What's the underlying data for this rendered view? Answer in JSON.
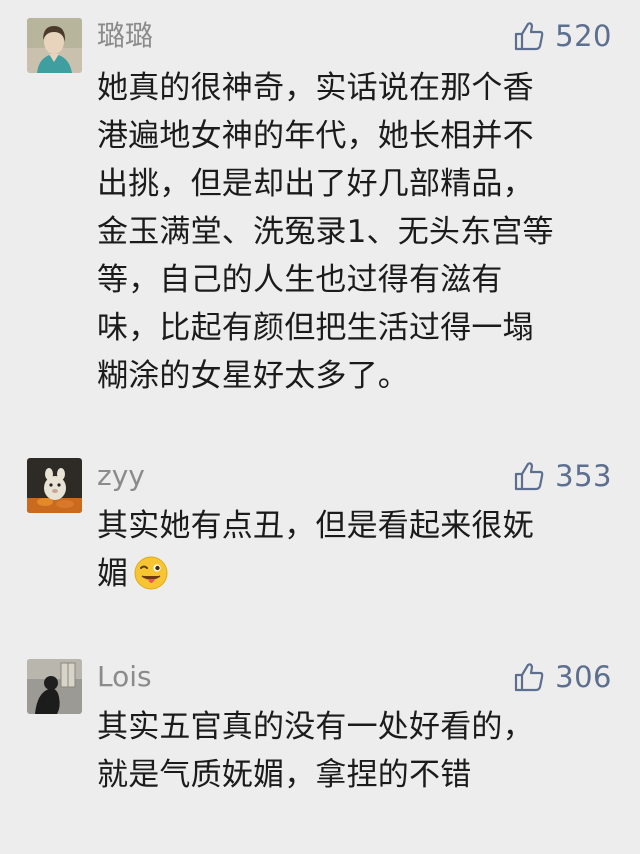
{
  "comments": [
    {
      "username": "璐璐",
      "likes": "520",
      "lines": [
        "她真的很神奇，实话说在那个香",
        "港遍地女神的年代，她长相并不",
        "出挑，但是却出了好几部精品，",
        "金玉满堂、洗冤录1、无头东宫等",
        "等，自己的人生也过得有滋有",
        "味，比起有颜但把生活过得一塌",
        "糊涂的女星好太多了。"
      ]
    },
    {
      "username": "zyy",
      "likes": "353",
      "lines": [
        "其实她有点丑，但是看起来很妩",
        "媚"
      ],
      "emoji": "winking-tongue-emoji"
    },
    {
      "username": "Lois",
      "likes": "306",
      "lines": [
        "其实五官真的没有一处好看的，",
        "就是气质妩媚，拿捏的不错"
      ]
    }
  ],
  "colors": {
    "background": "#ededed",
    "username": "#8b8b8b",
    "like_accent": "#5d6f8f",
    "text": "#1b1b1b"
  },
  "icons": {
    "like": "thumbs-up-outline-icon"
  }
}
